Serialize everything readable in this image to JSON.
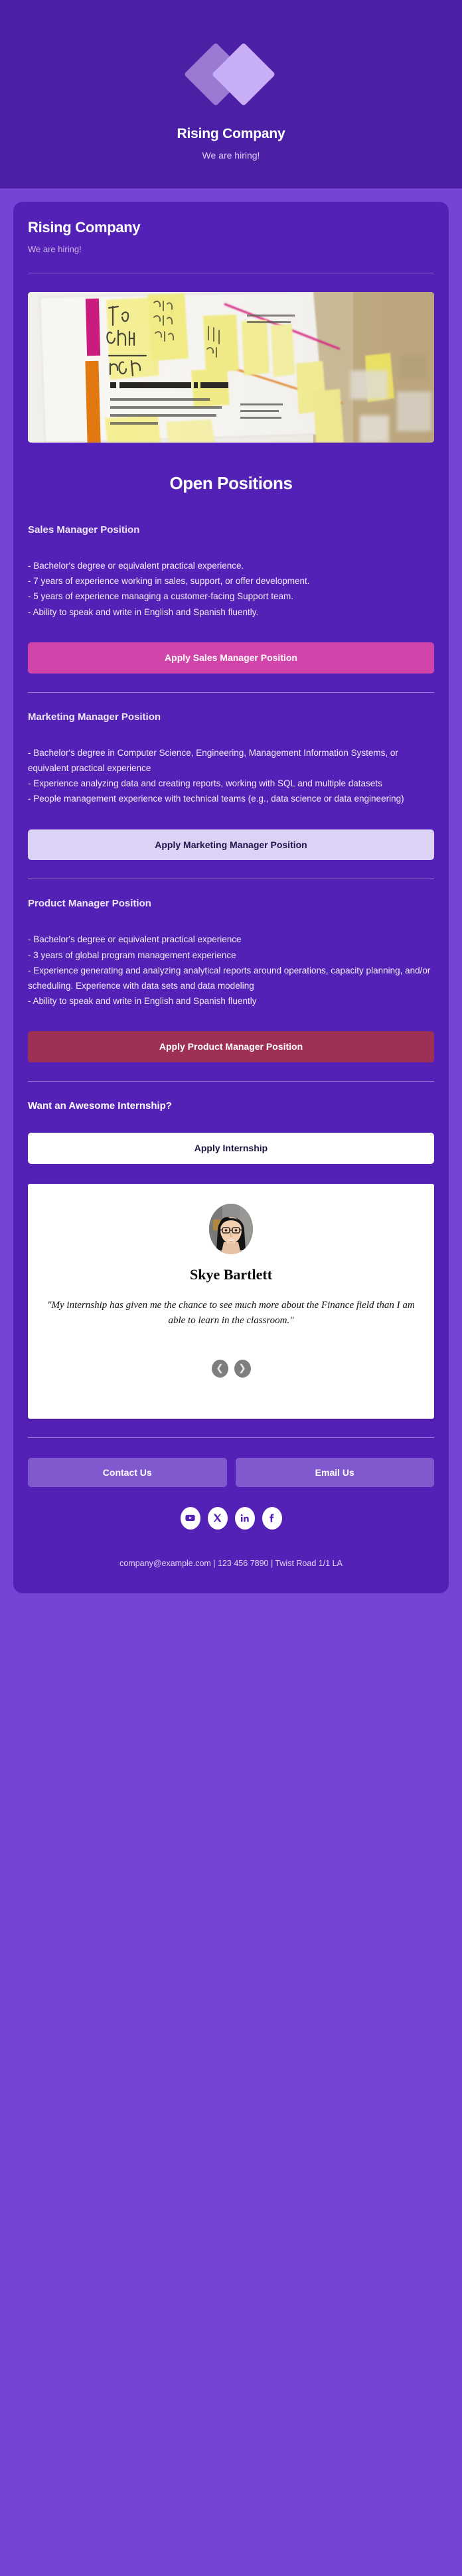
{
  "banner": {
    "logo_icon": "two-diamonds-logo-icon",
    "title": "Rising Company",
    "subtitle": "We are hiring!"
  },
  "card": {
    "title": "Rising Company",
    "subtitle": "We are hiring!",
    "hero_image_alt": "sticky-notes-whiteboard-photo",
    "section_heading": "Open Positions"
  },
  "jobs": [
    {
      "title": "Sales Manager Position",
      "description": "- Bachelor's degree or equivalent practical experience.\n- 7 years of experience working in sales, support, or offer development.\n- 5 years of experience managing a customer-facing Support team.\n- Ability to speak and write in English and Spanish fluently.",
      "apply_label": "Apply Sales Manager Position",
      "accent": "#D144A9"
    },
    {
      "title": "Marketing Manager Position",
      "description": "- Bachelor's degree in Computer Science, Engineering, Management Information Systems, or equivalent practical experience\n- Experience analyzing data and creating reports, working with SQL and multiple datasets\n- People management experience with technical teams (e.g., data science or data engineering)",
      "apply_label": "Apply Marketing Manager Position",
      "accent": "#DBD2F5"
    },
    {
      "title": "Product Manager Position",
      "description": "- Bachelor's degree or equivalent practical experience\n- 3 years of global program management experience\n- Experience generating and analyzing analytical reports around operations, capacity planning, and/or scheduling. Experience with data sets and data modeling\n- Ability to speak and write in English and Spanish fluently",
      "apply_label": "Apply Product Manager Position",
      "accent": "#9E3055"
    }
  ],
  "internship": {
    "heading": "Want an Awesome Internship?",
    "apply_label": "Apply Internship"
  },
  "testimonial": {
    "avatar_alt": "intern-portrait-photo",
    "name": "Skye Bartlett",
    "quote": "\"My internship has given me the chance to see much more about the Finance field than I am able to learn in the classroom.\"",
    "prev_icon": "chevron-left-icon",
    "next_icon": "chevron-right-icon"
  },
  "footer": {
    "contact_label": "Contact Us",
    "email_label": "Email Us",
    "socials": [
      {
        "name": "youtube-icon"
      },
      {
        "name": "x-twitter-icon"
      },
      {
        "name": "linkedin-icon"
      },
      {
        "name": "facebook-icon"
      }
    ],
    "contact_line": "company@example.com | 123 456 7890 | Twist Road 1/1 LA"
  },
  "colors": {
    "page_background": "#7544D4",
    "banner_background": "#4B20A5",
    "card_background": "#5421B6",
    "accent_pink": "#D144A9",
    "accent_lilac": "#DBD2F5",
    "accent_crimson": "#9E3055",
    "footer_button": "#8159CE"
  }
}
